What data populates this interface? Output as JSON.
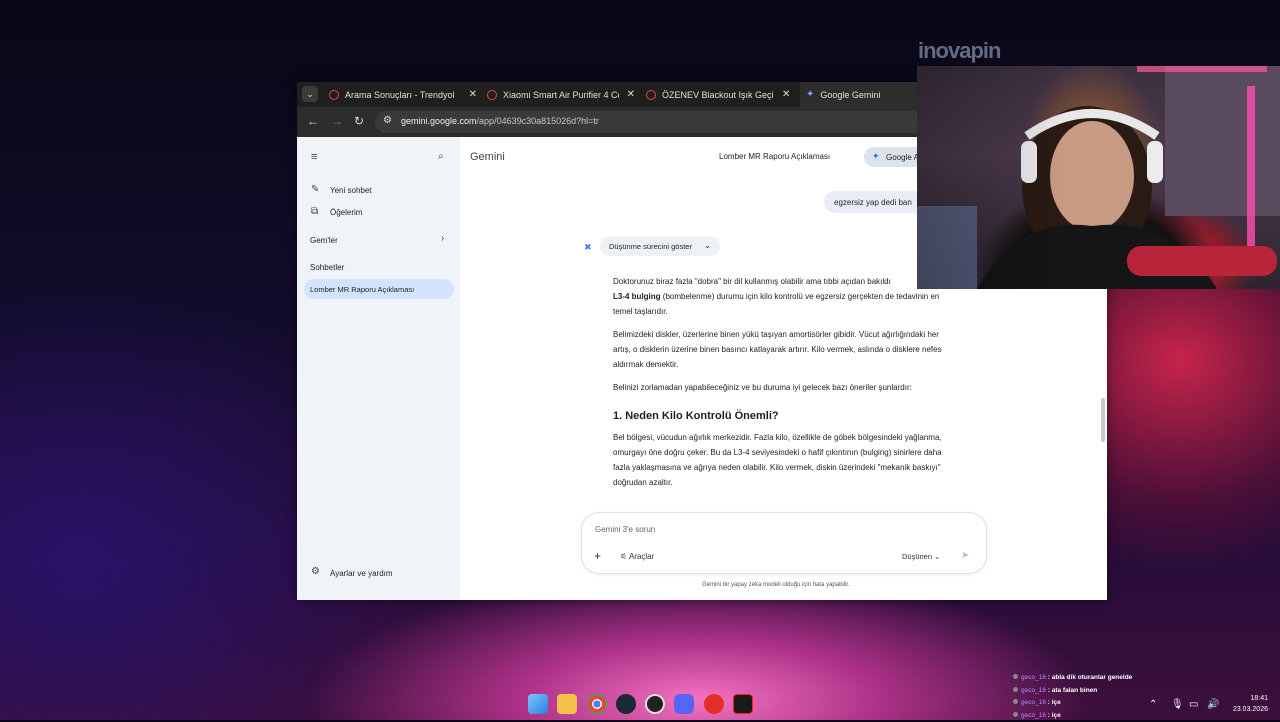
{
  "browser": {
    "tabs": [
      {
        "title": "Arama Sonuçları - Trendyol",
        "active": false
      },
      {
        "title": "Xiaomi Smart Air Purifier 4 Com",
        "active": false
      },
      {
        "title": "ÖZENEV Blackout Işık Geçirmez",
        "active": false
      },
      {
        "title": "Google Gemini",
        "active": true
      }
    ],
    "url_domain": "gemini.google.com",
    "url_path": "/app/04639c30a815026d?hl=tr"
  },
  "sidebar": {
    "new_chat": "Yeni sohbet",
    "items": "Öğelerim",
    "gems": "Gem'ler",
    "chats_header": "Sohbetler",
    "active_chat": "Lomber MR Raporu Açıklaması",
    "settings": "Ayarlar ve yardım"
  },
  "main": {
    "brand": "Gemini",
    "chat_title": "Lomber MR Raporu Açıklaması",
    "google_button": "Google A",
    "user_message": "egzersiz yap dedi ban",
    "thinking_toggle": "Düşünme sürecini göster",
    "response": {
      "p1_start": "Doktorunuz biraz fazla \"dobra\" bir dil kullanmış olabilir ama tıbbi açıdan bakıldı",
      "p1_bold": "L3-4 bulging",
      "p1_end": " (bombelenme) durumu için kilo kontrolü ve egzersiz gerçekten de tedavinin en temel taşlarıdır.",
      "p2": "Belimizdeki diskler, üzerlerine binen yükü taşıyan amortisörler gibidir. Vücut ağırlığındaki her artış, o disklerin üzerine binen basıncı katlayarak artırır. Kilo vermek, aslında o disklere nefes aldırmak demektir.",
      "p3": "Belinizi zorlamadan yapabileceğiniz ve bu duruma iyi gelecek bazı öneriler şunlardır:",
      "h1": "1. Neden Kilo Kontrolü Önemli?",
      "p4": "Bel bölgesi, vücudun ağırlık merkezidir. Fazla kilo, özellikle de göbek bölgesindeki yağlanma, omurgayı öne doğru çeker. Bu da L3-4 seviyesindeki o hafif çıkıntının (bulging) sinirlere daha fazla yaklaşmasına ve ağrıya neden olabilir. Kilo vermek, diskin üzerindeki \"mekanik baskıyı\" doğrudan azaltır."
    },
    "composer_placeholder": "Gemini 3'e sorun",
    "tools_label": "Araçlar",
    "mode_label": "Düşünen",
    "disclaimer": "Gemini bir yapay zeka modeli olduğu için hata yapabilir."
  },
  "overlay": {
    "logo": "inovapin",
    "chat": [
      {
        "user": "geco_16",
        "msg": "abla dik oturanlar genelde"
      },
      {
        "user": "geco_16",
        "msg": "ata falan binen"
      },
      {
        "user": "geco_16",
        "msg": "içe"
      },
      {
        "user": "geco_16",
        "msg": "içe"
      }
    ]
  },
  "taskbar": {
    "time": "18:41",
    "date": "23.03.2026",
    "icons": [
      "windows-start",
      "file-explorer",
      "chrome",
      "steam",
      "obs",
      "discord",
      "youtube-music",
      "app"
    ]
  }
}
